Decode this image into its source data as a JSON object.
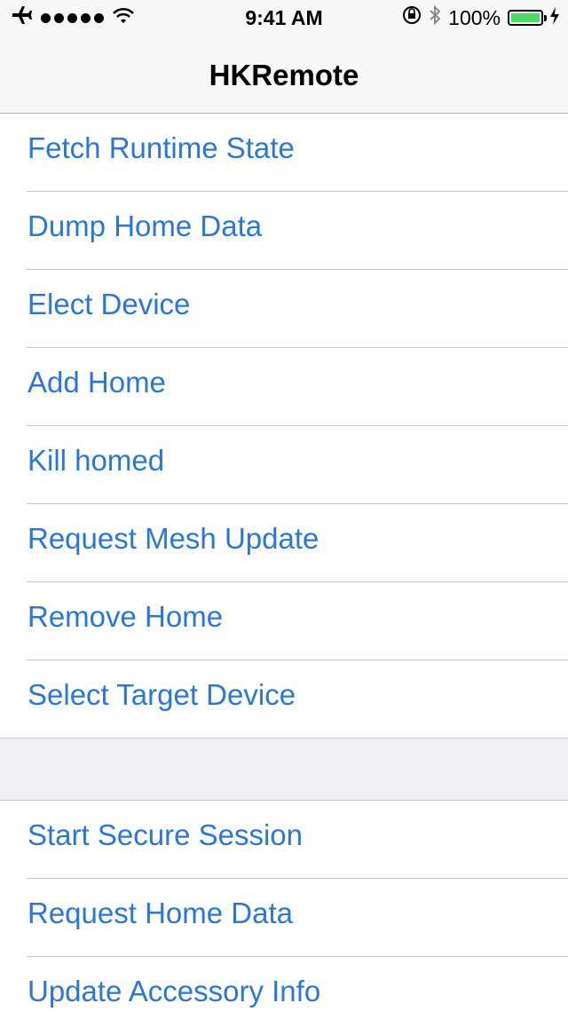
{
  "status_bar": {
    "time": "9:41 AM",
    "battery_percent": "100%",
    "signal_bars": 5
  },
  "nav": {
    "title": "HKRemote"
  },
  "sections": [
    {
      "items": [
        {
          "label": "Fetch Runtime State"
        },
        {
          "label": "Dump Home Data"
        },
        {
          "label": "Elect Device"
        },
        {
          "label": "Add Home"
        },
        {
          "label": "Kill homed"
        },
        {
          "label": "Request Mesh Update"
        },
        {
          "label": "Remove Home"
        },
        {
          "label": "Select Target Device"
        }
      ]
    },
    {
      "items": [
        {
          "label": "Start Secure Session"
        },
        {
          "label": "Request Home Data"
        },
        {
          "label": "Update Accessory Info"
        }
      ]
    }
  ],
  "colors": {
    "accent": "#2b78d4",
    "battery": "#4cd964"
  }
}
